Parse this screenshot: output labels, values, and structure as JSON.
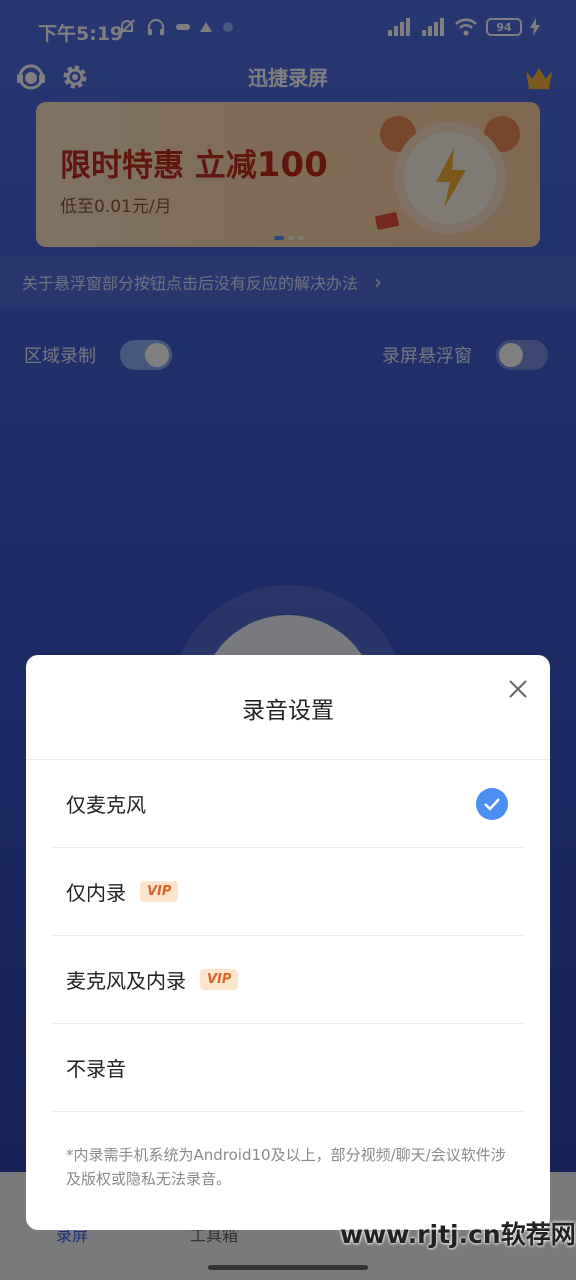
{
  "status_bar": {
    "time": "下午5:19",
    "battery": "94"
  },
  "header": {
    "title": "迅捷录屏"
  },
  "banner": {
    "title": "限时特惠 立减",
    "title_number": "100",
    "subtitle": "低至0.01元/月"
  },
  "notice": {
    "text": "关于悬浮窗部分按钮点击后没有反应的解决办法",
    "chevron": "›"
  },
  "toggles": [
    {
      "label": "区域录制",
      "state": "on"
    },
    {
      "label": "录屏悬浮窗",
      "state": "off"
    }
  ],
  "bottom_nav": {
    "tabs": [
      {
        "label": "录屏"
      },
      {
        "label": "工具箱"
      }
    ]
  },
  "modal": {
    "title": "录音设置",
    "options": [
      {
        "label": "仅麦克风",
        "vip": "",
        "selected": true
      },
      {
        "label": "仅内录",
        "vip": "VIP",
        "selected": false
      },
      {
        "label": "麦克风及内录",
        "vip": "VIP",
        "selected": false
      },
      {
        "label": "不录音",
        "vip": "",
        "selected": false
      }
    ],
    "footnote": "*内录需手机系统为Android10及以上，部分视频/聊天/会议软件涉及版权或隐私无法录音。"
  },
  "watermark": "www.rjtj.cn软荐网",
  "colors": {
    "accent": "#4a90f2",
    "vip_text": "#d9652b",
    "vip_bg": "#fde4cc",
    "banner_title": "#c02a1c"
  },
  "icons": [
    "bell-off-icon",
    "headphones-icon",
    "signal-icon",
    "wifi-icon",
    "battery-icon",
    "charging-icon",
    "support-icon",
    "gear-icon",
    "crown-icon",
    "alarm-clock-icon",
    "chevron-right-icon",
    "close-icon",
    "check-icon"
  ]
}
